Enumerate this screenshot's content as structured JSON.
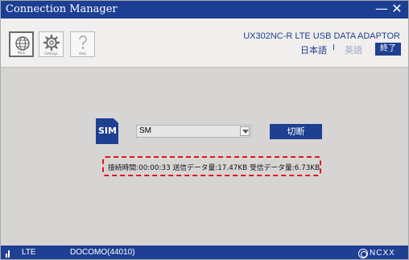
{
  "window": {
    "title": "Connection Manager",
    "minimize_glyph": "—",
    "close_glyph": "✕"
  },
  "toolbar": {
    "buttons": [
      {
        "icon": "globe-icon",
        "caption": "Main"
      },
      {
        "icon": "gear-icon",
        "caption": "Settings"
      },
      {
        "icon": "question-icon",
        "caption": "Help"
      }
    ]
  },
  "header": {
    "device_name": "UX302NC-R LTE USB DATA ADAPTOR",
    "lang_jp": "日本語",
    "lang_sep": "I",
    "lang_en": "英語",
    "exit_label": "終了"
  },
  "connection": {
    "sim_label": "SIM",
    "profile_value": "SM",
    "disconnect_label": "切断",
    "status_text": "接続時間:00:00:33  送信データ量:17.47KB  受信データ量:6.73KB"
  },
  "statusbar": {
    "network_type": "LTE",
    "carrier": "DOCOMO(44010)",
    "logo_text": "NCXX",
    "signal_bars": 2
  },
  "colors": {
    "brand_blue": "#1f3f93",
    "background": "#d7d5d3",
    "status_border": "#e01616"
  }
}
